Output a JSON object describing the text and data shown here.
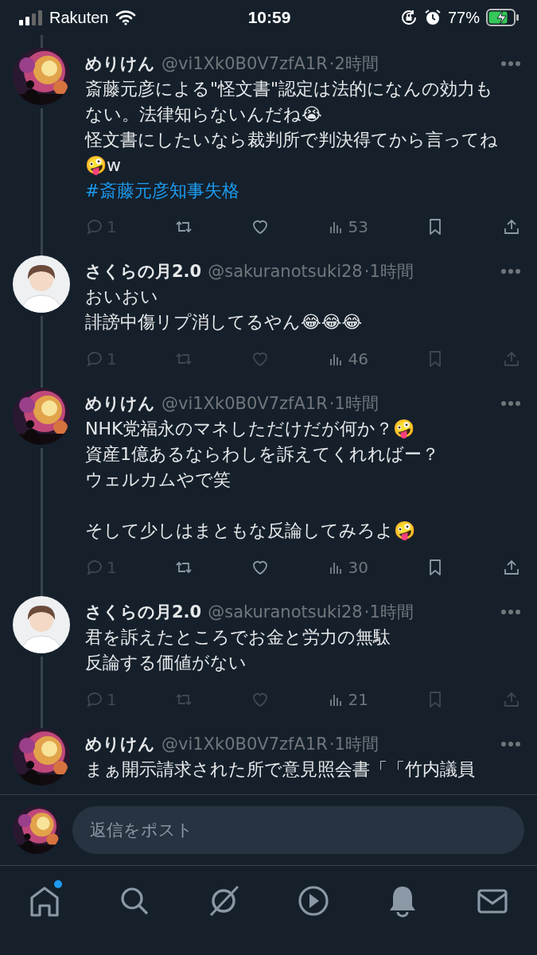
{
  "status_bar": {
    "carrier": "Rakuten",
    "time": "10:59",
    "battery": "77%"
  },
  "posts": [
    {
      "avatar": {
        "kind": "picture"
      },
      "name": "めりけん",
      "handle": "@vi1Xk0B0V7zfA1R",
      "time": "·2時間",
      "paragraphs": [
        [
          "斎藤元彦による\"怪文書\"認定は法的になんの効力もない。法律知らないんだね😭",
          "怪文書にしたいなら裁判所で判決得てから言ってね🤪w"
        ]
      ],
      "hashtag": "#斎藤元彦知事失格",
      "actions": {
        "replies": "1",
        "views": "53",
        "dimmed": false
      }
    },
    {
      "avatar": {
        "kind": "silhouette"
      },
      "name": "さくらの月2.0",
      "handle": "@sakuranotsuki28",
      "time": "·1時間",
      "paragraphs": [
        [
          "おいおい",
          "誹謗中傷リプ消してるやん😂😂😂"
        ]
      ],
      "actions": {
        "replies": "1",
        "views": "46",
        "dimmed": true
      }
    },
    {
      "avatar": {
        "kind": "picture"
      },
      "name": "めりけん",
      "handle": "@vi1Xk0B0V7zfA1R",
      "time": "·1時間",
      "paragraphs": [
        [
          "NHK党福永のマネしただけだが何か？🤪",
          "資産1億あるならわしを訴えてくれればー？",
          "ウェルカムやで笑"
        ],
        [
          "そして少しはまともな反論してみろよ🤪"
        ]
      ],
      "actions": {
        "replies": "1",
        "views": "30",
        "dimmed": false
      }
    },
    {
      "avatar": {
        "kind": "silhouette"
      },
      "name": "さくらの月2.0",
      "handle": "@sakuranotsuki28",
      "time": "·1時間",
      "paragraphs": [
        [
          "君を訴えたところでお金と労力の無駄",
          "反論する価値がない"
        ]
      ],
      "actions": {
        "replies": "1",
        "views": "21",
        "dimmed": true
      }
    },
    {
      "avatar": {
        "kind": "picture"
      },
      "name": "めりけん",
      "handle": "@vi1Xk0B0V7zfA1R",
      "time": "·1時間",
      "paragraphs": [
        [
          "まぁ開示請求された所で意見照会書「「竹内議員"
        ]
      ]
    }
  ],
  "reply_bar": {
    "avatar": {
      "kind": "picture"
    },
    "placeholder": "返信をポスト"
  },
  "tab_bar": [
    {
      "badge": true
    },
    {
      "badge": false
    },
    {
      "badge": false
    },
    {
      "badge": false
    },
    {
      "badge": false
    },
    {
      "badge": false
    }
  ]
}
